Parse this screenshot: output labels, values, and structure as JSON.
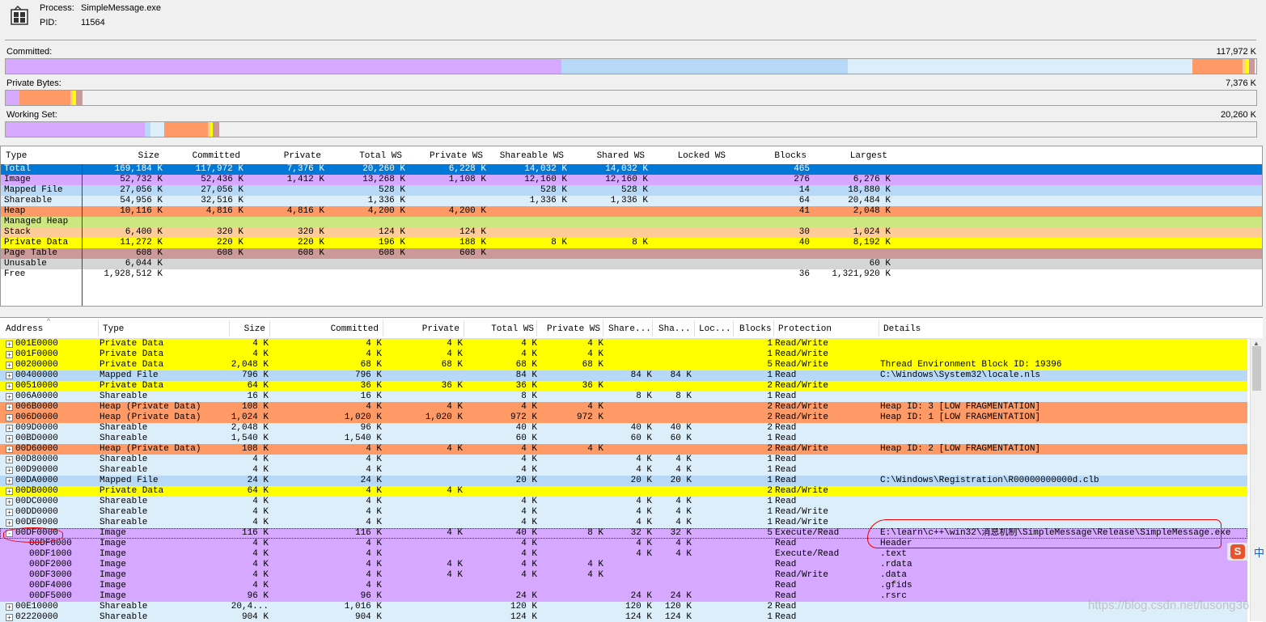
{
  "header": {
    "process_label": "Process:",
    "process_value": "SimpleMessage.exe",
    "pid_label": "PID:",
    "pid_value": "11564"
  },
  "bars": {
    "committed_label": "Committed:",
    "committed_value": "117,972 K",
    "private_label": "Private Bytes:",
    "private_value": "7,376 K",
    "ws_label": "Working Set:",
    "ws_value": "20,260 K"
  },
  "colors": {
    "image": "#d7a8ff",
    "mapped": "#b7d8f7",
    "shareable": "#ddeefb",
    "heap": "#ff9966",
    "managed_heap": "#cce680",
    "stack": "#ffcc99",
    "private_data": "#ffff00",
    "page_table": "#cc9999",
    "unusable": "#d5d5d5",
    "total_selected": "#0078d7"
  },
  "summary": {
    "columns": [
      "Type",
      "Size",
      "Committed",
      "Private",
      "Total WS",
      "Private WS",
      "Shareable WS",
      "Shared WS",
      "Locked WS",
      "Blocks",
      "Largest"
    ],
    "rows": [
      {
        "type": "Total",
        "size": "169,184 K",
        "committed": "117,972 K",
        "private": "7,376 K",
        "total_ws": "20,260 K",
        "private_ws": "6,228 K",
        "shareable_ws": "14,032 K",
        "shared_ws": "14,032 K",
        "locked_ws": "",
        "blocks": "465",
        "largest": ""
      },
      {
        "type": "Image",
        "size": "52,732 K",
        "committed": "52,436 K",
        "private": "1,412 K",
        "total_ws": "13,268 K",
        "private_ws": "1,108 K",
        "shareable_ws": "12,160 K",
        "shared_ws": "12,160 K",
        "locked_ws": "",
        "blocks": "276",
        "largest": "6,276 K"
      },
      {
        "type": "Mapped File",
        "size": "27,056 K",
        "committed": "27,056 K",
        "private": "",
        "total_ws": "528 K",
        "private_ws": "",
        "shareable_ws": "528 K",
        "shared_ws": "528 K",
        "locked_ws": "",
        "blocks": "14",
        "largest": "18,880 K"
      },
      {
        "type": "Shareable",
        "size": "54,956 K",
        "committed": "32,516 K",
        "private": "",
        "total_ws": "1,336 K",
        "private_ws": "",
        "shareable_ws": "1,336 K",
        "shared_ws": "1,336 K",
        "locked_ws": "",
        "blocks": "64",
        "largest": "20,484 K"
      },
      {
        "type": "Heap",
        "size": "10,116 K",
        "committed": "4,816 K",
        "private": "4,816 K",
        "total_ws": "4,200 K",
        "private_ws": "4,200 K",
        "shareable_ws": "",
        "shared_ws": "",
        "locked_ws": "",
        "blocks": "41",
        "largest": "2,048 K"
      },
      {
        "type": "Managed Heap",
        "size": "",
        "committed": "",
        "private": "",
        "total_ws": "",
        "private_ws": "",
        "shareable_ws": "",
        "shared_ws": "",
        "locked_ws": "",
        "blocks": "",
        "largest": ""
      },
      {
        "type": "Stack",
        "size": "6,400 K",
        "committed": "320 K",
        "private": "320 K",
        "total_ws": "124 K",
        "private_ws": "124 K",
        "shareable_ws": "",
        "shared_ws": "",
        "locked_ws": "",
        "blocks": "30",
        "largest": "1,024 K"
      },
      {
        "type": "Private Data",
        "size": "11,272 K",
        "committed": "220 K",
        "private": "220 K",
        "total_ws": "196 K",
        "private_ws": "188 K",
        "shareable_ws": "8 K",
        "shared_ws": "8 K",
        "locked_ws": "",
        "blocks": "40",
        "largest": "8,192 K"
      },
      {
        "type": "Page Table",
        "size": "608 K",
        "committed": "608 K",
        "private": "608 K",
        "total_ws": "608 K",
        "private_ws": "608 K",
        "shareable_ws": "",
        "shared_ws": "",
        "locked_ws": "",
        "blocks": "",
        "largest": ""
      },
      {
        "type": "Unusable",
        "size": "6,044 K",
        "committed": "",
        "private": "",
        "total_ws": "",
        "private_ws": "",
        "shareable_ws": "",
        "shared_ws": "",
        "locked_ws": "",
        "blocks": "",
        "largest": "60 K"
      },
      {
        "type": "Free",
        "size": "1,928,512 K",
        "committed": "",
        "private": "",
        "total_ws": "",
        "private_ws": "",
        "shareable_ws": "",
        "shared_ws": "",
        "locked_ws": "",
        "blocks": "36",
        "largest": "1,321,920 K"
      }
    ]
  },
  "detail": {
    "columns": [
      "Address",
      "Type",
      "Size",
      "Committed",
      "Private",
      "Total WS",
      "Private WS",
      "Share...",
      "Sha...",
      "Loc...",
      "Blocks",
      "Protection",
      "Details"
    ],
    "rows": [
      {
        "address": "001E0000",
        "type": "Private Data",
        "size": "4 K",
        "committed": "4 K",
        "private": "4 K",
        "total_ws": "4 K",
        "private_ws": "4 K",
        "share": "",
        "sha": "",
        "loc": "",
        "blocks": "1",
        "protection": "Read/Write",
        "details": "",
        "kind": "private_data",
        "expand": "+"
      },
      {
        "address": "001F0000",
        "type": "Private Data",
        "size": "4 K",
        "committed": "4 K",
        "private": "4 K",
        "total_ws": "4 K",
        "private_ws": "4 K",
        "share": "",
        "sha": "",
        "loc": "",
        "blocks": "1",
        "protection": "Read/Write",
        "details": "",
        "kind": "private_data",
        "expand": "+"
      },
      {
        "address": "00200000",
        "type": "Private Data",
        "size": "2,048 K",
        "committed": "68 K",
        "private": "68 K",
        "total_ws": "68 K",
        "private_ws": "68 K",
        "share": "",
        "sha": "",
        "loc": "",
        "blocks": "5",
        "protection": "Read/Write",
        "details": "Thread Environment Block ID: 19396",
        "kind": "private_data",
        "expand": "+"
      },
      {
        "address": "00400000",
        "type": "Mapped File",
        "size": "796 K",
        "committed": "796 K",
        "private": "",
        "total_ws": "84 K",
        "private_ws": "",
        "share": "84 K",
        "sha": "84 K",
        "loc": "",
        "blocks": "1",
        "protection": "Read",
        "details": "C:\\Windows\\System32\\locale.nls",
        "kind": "mapped",
        "expand": "+"
      },
      {
        "address": "00510000",
        "type": "Private Data",
        "size": "64 K",
        "committed": "36 K",
        "private": "36 K",
        "total_ws": "36 K",
        "private_ws": "36 K",
        "share": "",
        "sha": "",
        "loc": "",
        "blocks": "2",
        "protection": "Read/Write",
        "details": "",
        "kind": "private_data",
        "expand": "+"
      },
      {
        "address": "006A0000",
        "type": "Shareable",
        "size": "16 K",
        "committed": "16 K",
        "private": "",
        "total_ws": "8 K",
        "private_ws": "",
        "share": "8 K",
        "sha": "8 K",
        "loc": "",
        "blocks": "1",
        "protection": "Read",
        "details": "",
        "kind": "shareable",
        "expand": "+"
      },
      {
        "address": "006B0000",
        "type": "Heap (Private Data)",
        "size": "108 K",
        "committed": "4 K",
        "private": "4 K",
        "total_ws": "4 K",
        "private_ws": "4 K",
        "share": "",
        "sha": "",
        "loc": "",
        "blocks": "2",
        "protection": "Read/Write",
        "details": "Heap ID: 3 [LOW FRAGMENTATION]",
        "kind": "heap",
        "expand": "+"
      },
      {
        "address": "006D0000",
        "type": "Heap (Private Data)",
        "size": "1,024 K",
        "committed": "1,020 K",
        "private": "1,020 K",
        "total_ws": "972 K",
        "private_ws": "972 K",
        "share": "",
        "sha": "",
        "loc": "",
        "blocks": "2",
        "protection": "Read/Write",
        "details": "Heap ID: 1 [LOW FRAGMENTATION]",
        "kind": "heap",
        "expand": "+"
      },
      {
        "address": "009D0000",
        "type": "Shareable",
        "size": "2,048 K",
        "committed": "96 K",
        "private": "",
        "total_ws": "40 K",
        "private_ws": "",
        "share": "40 K",
        "sha": "40 K",
        "loc": "",
        "blocks": "2",
        "protection": "Read",
        "details": "",
        "kind": "shareable",
        "expand": "+"
      },
      {
        "address": "00BD0000",
        "type": "Shareable",
        "size": "1,540 K",
        "committed": "1,540 K",
        "private": "",
        "total_ws": "60 K",
        "private_ws": "",
        "share": "60 K",
        "sha": "60 K",
        "loc": "",
        "blocks": "1",
        "protection": "Read",
        "details": "",
        "kind": "shareable",
        "expand": "+"
      },
      {
        "address": "00D60000",
        "type": "Heap (Private Data)",
        "size": "108 K",
        "committed": "4 K",
        "private": "4 K",
        "total_ws": "4 K",
        "private_ws": "4 K",
        "share": "",
        "sha": "",
        "loc": "",
        "blocks": "2",
        "protection": "Read/Write",
        "details": "Heap ID: 2 [LOW FRAGMENTATION]",
        "kind": "heap",
        "expand": "+"
      },
      {
        "address": "00D80000",
        "type": "Shareable",
        "size": "4 K",
        "committed": "4 K",
        "private": "",
        "total_ws": "4 K",
        "private_ws": "",
        "share": "4 K",
        "sha": "4 K",
        "loc": "",
        "blocks": "1",
        "protection": "Read",
        "details": "",
        "kind": "shareable",
        "expand": "+"
      },
      {
        "address": "00D90000",
        "type": "Shareable",
        "size": "4 K",
        "committed": "4 K",
        "private": "",
        "total_ws": "4 K",
        "private_ws": "",
        "share": "4 K",
        "sha": "4 K",
        "loc": "",
        "blocks": "1",
        "protection": "Read",
        "details": "",
        "kind": "shareable",
        "expand": "+"
      },
      {
        "address": "00DA0000",
        "type": "Mapped File",
        "size": "24 K",
        "committed": "24 K",
        "private": "",
        "total_ws": "20 K",
        "private_ws": "",
        "share": "20 K",
        "sha": "20 K",
        "loc": "",
        "blocks": "1",
        "protection": "Read",
        "details": "C:\\Windows\\Registration\\R00000000000d.clb",
        "kind": "mapped",
        "expand": "+"
      },
      {
        "address": "00DB0000",
        "type": "Private Data",
        "size": "64 K",
        "committed": "4 K",
        "private": "4 K",
        "total_ws": "",
        "private_ws": "",
        "share": "",
        "sha": "",
        "loc": "",
        "blocks": "2",
        "protection": "Read/Write",
        "details": "",
        "kind": "private_data",
        "expand": "+"
      },
      {
        "address": "00DC0000",
        "type": "Shareable",
        "size": "4 K",
        "committed": "4 K",
        "private": "",
        "total_ws": "4 K",
        "private_ws": "",
        "share": "4 K",
        "sha": "4 K",
        "loc": "",
        "blocks": "1",
        "protection": "Read",
        "details": "",
        "kind": "shareable",
        "expand": "+"
      },
      {
        "address": "00DD0000",
        "type": "Shareable",
        "size": "4 K",
        "committed": "4 K",
        "private": "",
        "total_ws": "4 K",
        "private_ws": "",
        "share": "4 K",
        "sha": "4 K",
        "loc": "",
        "blocks": "1",
        "protection": "Read/Write",
        "details": "",
        "kind": "shareable",
        "expand": "+"
      },
      {
        "address": "00DE0000",
        "type": "Shareable",
        "size": "4 K",
        "committed": "4 K",
        "private": "",
        "total_ws": "4 K",
        "private_ws": "",
        "share": "4 K",
        "sha": "4 K",
        "loc": "",
        "blocks": "1",
        "protection": "Read/Write",
        "details": "",
        "kind": "shareable",
        "expand": "+"
      },
      {
        "address": "00DF0000",
        "type": "Image",
        "size": "116 K",
        "committed": "116 K",
        "private": "4 K",
        "total_ws": "40 K",
        "private_ws": "8 K",
        "share": "32 K",
        "sha": "32 K",
        "loc": "",
        "blocks": "5",
        "protection": "Execute/Read",
        "details": "E:\\learn\\c++\\win32\\消息机制\\SimpleMessage\\Release\\SimpleMessage.exe",
        "kind": "image",
        "expand": "-"
      },
      {
        "address": "00DF0000",
        "type": "Image",
        "size": "4 K",
        "committed": "4 K",
        "private": "",
        "total_ws": "4 K",
        "private_ws": "",
        "share": "4 K",
        "sha": "4 K",
        "loc": "",
        "blocks": "",
        "protection": "Read",
        "details": "Header",
        "kind": "image",
        "expand": ""
      },
      {
        "address": "00DF1000",
        "type": "Image",
        "size": "4 K",
        "committed": "4 K",
        "private": "",
        "total_ws": "4 K",
        "private_ws": "",
        "share": "4 K",
        "sha": "4 K",
        "loc": "",
        "blocks": "",
        "protection": "Execute/Read",
        "details": ".text",
        "kind": "image",
        "expand": ""
      },
      {
        "address": "00DF2000",
        "type": "Image",
        "size": "4 K",
        "committed": "4 K",
        "private": "4 K",
        "total_ws": "4 K",
        "private_ws": "4 K",
        "share": "",
        "sha": "",
        "loc": "",
        "blocks": "",
        "protection": "Read",
        "details": ".rdata",
        "kind": "image",
        "expand": ""
      },
      {
        "address": "00DF3000",
        "type": "Image",
        "size": "4 K",
        "committed": "4 K",
        "private": "4 K",
        "total_ws": "4 K",
        "private_ws": "4 K",
        "share": "",
        "sha": "",
        "loc": "",
        "blocks": "",
        "protection": "Read/Write",
        "details": ".data",
        "kind": "image",
        "expand": ""
      },
      {
        "address": "00DF4000",
        "type": "Image",
        "size": "4 K",
        "committed": "4 K",
        "private": "",
        "total_ws": "",
        "private_ws": "",
        "share": "",
        "sha": "",
        "loc": "",
        "blocks": "",
        "protection": "Read",
        "details": ".gfids",
        "kind": "image",
        "expand": ""
      },
      {
        "address": "00DF5000",
        "type": "Image",
        "size": "96 K",
        "committed": "96 K",
        "private": "",
        "total_ws": "24 K",
        "private_ws": "",
        "share": "24 K",
        "sha": "24 K",
        "loc": "",
        "blocks": "",
        "protection": "Read",
        "details": ".rsrc",
        "kind": "image",
        "expand": ""
      },
      {
        "address": "00E10000",
        "type": "Shareable",
        "size": "20,4...",
        "committed": "1,016 K",
        "private": "",
        "total_ws": "120 K",
        "private_ws": "",
        "share": "120 K",
        "sha": "120 K",
        "loc": "",
        "blocks": "2",
        "protection": "Read",
        "details": "",
        "kind": "shareable",
        "expand": "+"
      },
      {
        "address": "02220000",
        "type": "Shareable",
        "size": "904 K",
        "committed": "904 K",
        "private": "",
        "total_ws": "124 K",
        "private_ws": "",
        "share": "124 K",
        "sha": "124 K",
        "loc": "",
        "blocks": "1",
        "protection": "Read",
        "details": "",
        "kind": "shareable",
        "expand": "+"
      }
    ]
  },
  "overlay": {
    "ime_icon": "S",
    "ime_lang": "中",
    "watermark": "https://blog.csdn.net/lusong36"
  }
}
